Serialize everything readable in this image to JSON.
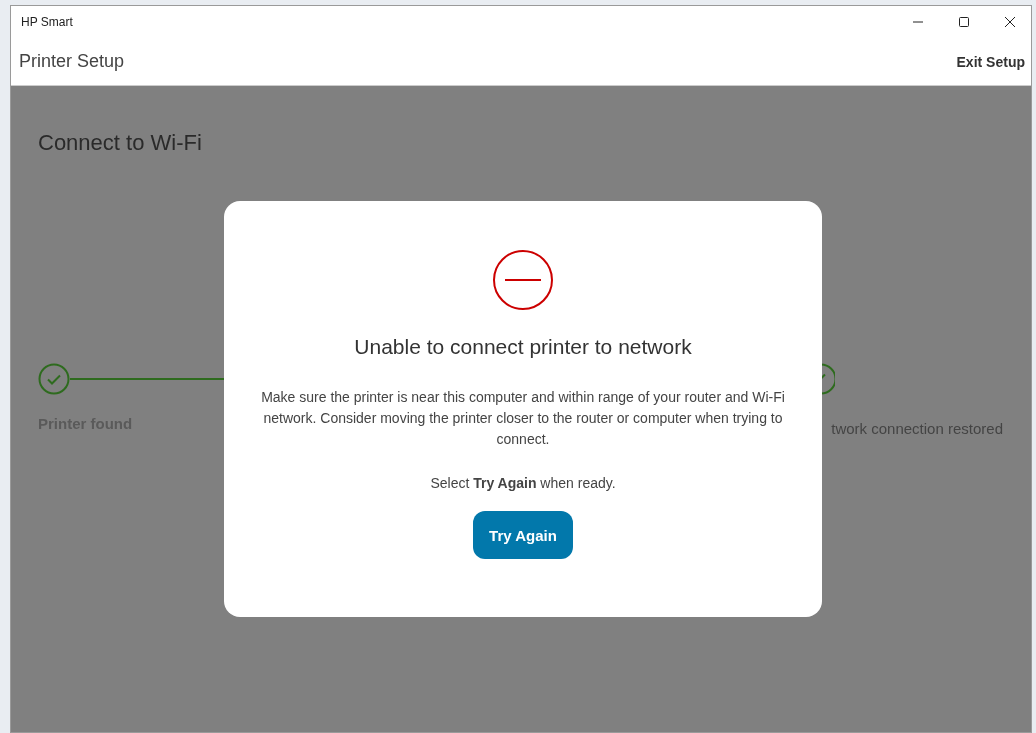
{
  "window": {
    "title": "HP Smart"
  },
  "header": {
    "title": "Printer Setup",
    "exit_label": "Exit Setup"
  },
  "page": {
    "title": "Connect to Wi-Fi",
    "steps": [
      {
        "label": "Printer found",
        "done": true
      },
      {
        "label": "twork connection restored",
        "done": true
      }
    ]
  },
  "dialog": {
    "title": "Unable to connect printer to network",
    "message": "Make sure the printer is near this computer and within range of your router and Wi-Fi network. Consider moving the printer closer to the router or computer when trying to connect.",
    "hint": "Select **Try Again** when ready.",
    "button": "Try Again"
  }
}
